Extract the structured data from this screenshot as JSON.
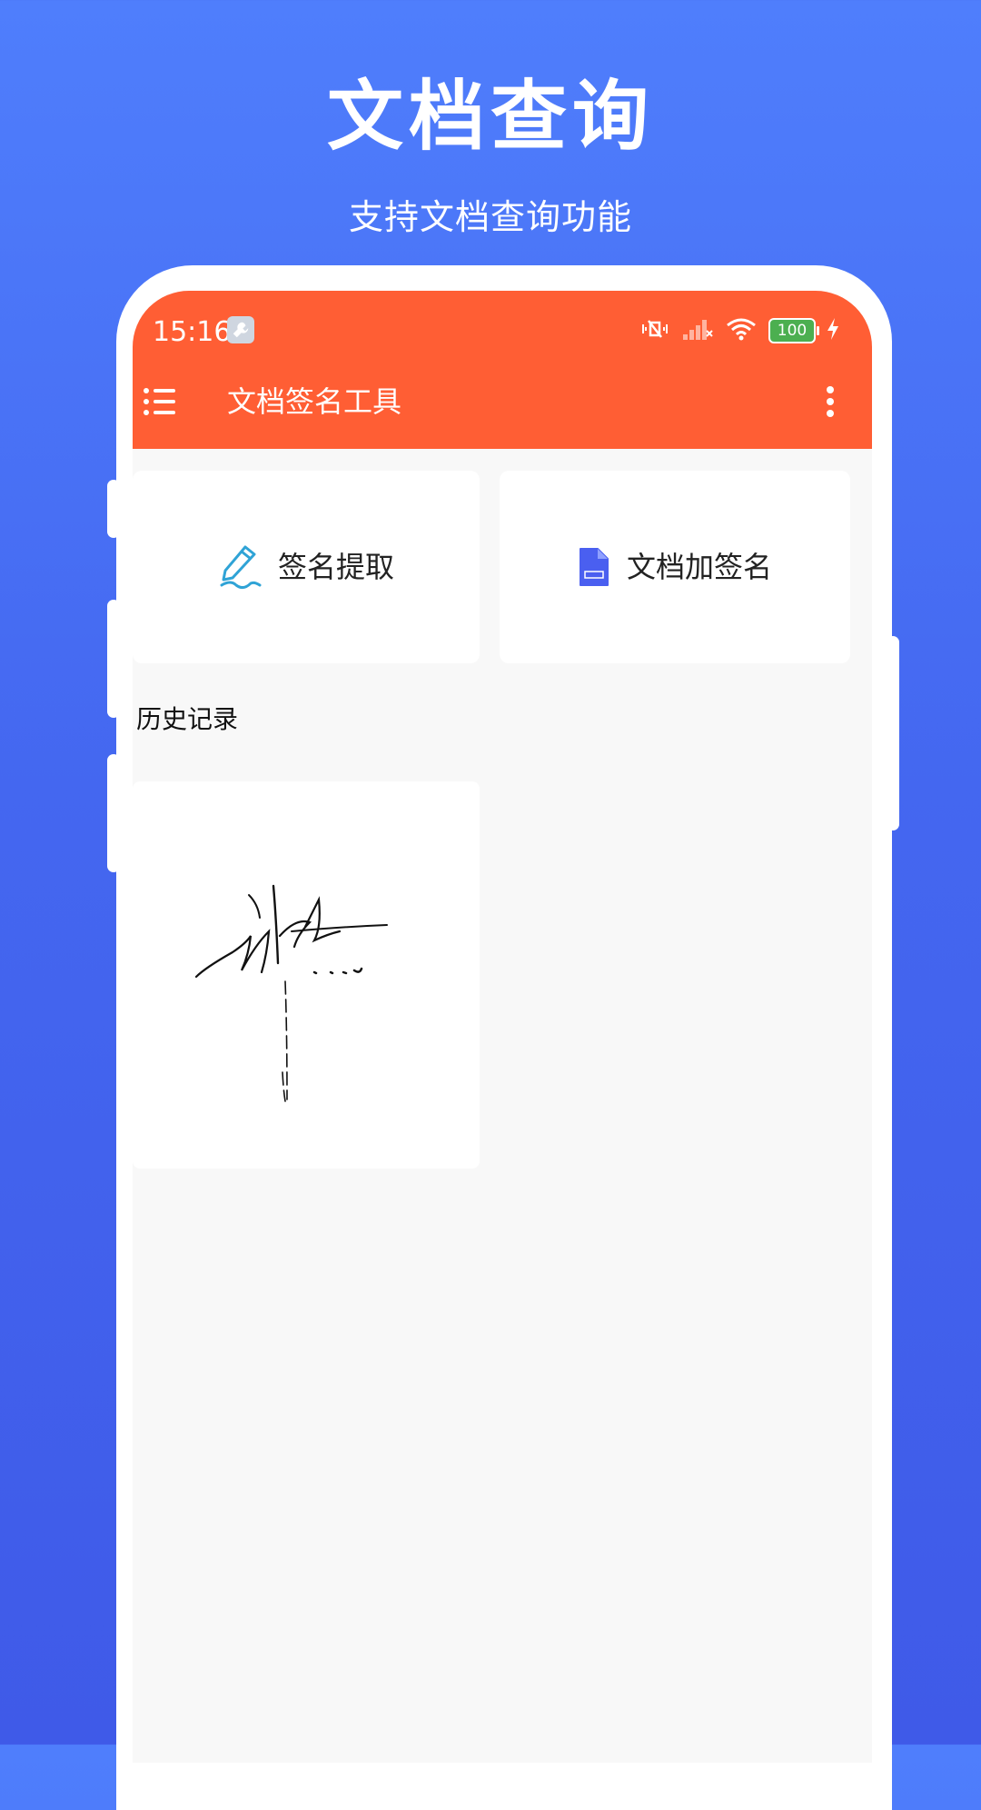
{
  "promo": {
    "title": "文档查询",
    "subtitle": "支持文档查询功能"
  },
  "status_bar": {
    "time": "15:16",
    "battery": "100",
    "icons": [
      "wrench-icon",
      "vibrate-mute-icon",
      "signal-icon",
      "wifi-icon",
      "battery-icon",
      "charging-icon"
    ]
  },
  "app_bar": {
    "title": "文档签名工具",
    "color": "#ff5e34"
  },
  "actions": [
    {
      "label": "签名提取",
      "icon": "pen-signature-icon"
    },
    {
      "label": "文档加签名",
      "icon": "document-icon"
    }
  ],
  "history": {
    "title": "历史记录",
    "items": [
      {
        "type": "signature-thumbnail"
      }
    ]
  },
  "colors": {
    "background": "#4f7efc",
    "accent": "#ff5e34",
    "document_icon": "#4a5ff0",
    "pen_icon": "#2fa3d6"
  }
}
